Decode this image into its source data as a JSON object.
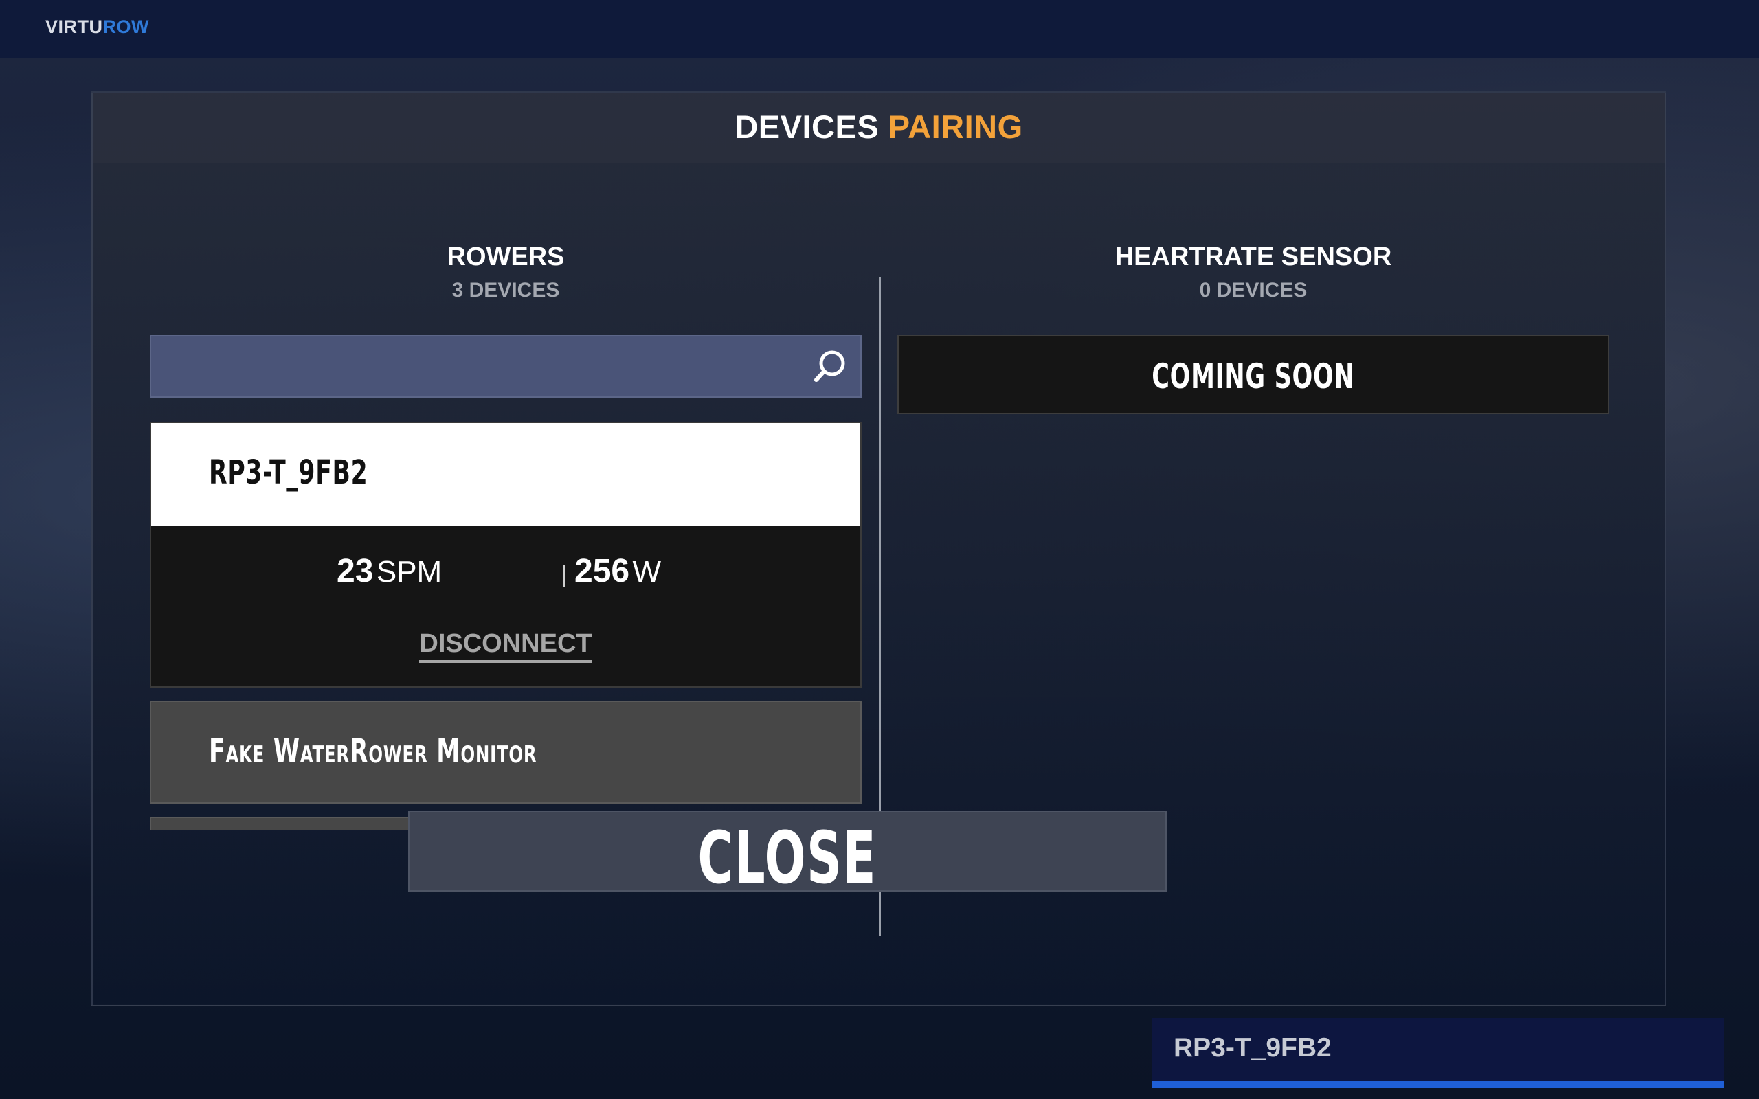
{
  "app": {
    "logo_part1": "VIRTU",
    "logo_part2": "ROW",
    "brand_color": "#2f7ad9"
  },
  "dialog": {
    "title_part1": "DEVICES",
    "title_part2": "PAIRING",
    "accent_color": "#f3a23a"
  },
  "rowers": {
    "heading": "ROWERS",
    "count": "3 DEVICES",
    "search": {
      "value": "",
      "icon": "search-icon"
    },
    "devices": [
      {
        "name": "RP3-T_9FB2",
        "connected": true,
        "spm_value": "23",
        "spm_unit": "SPM",
        "power_value": "256",
        "power_unit": "W",
        "action_label": "DISCONNECT"
      },
      {
        "name": "Fake WaterRower Monitor",
        "connected": false
      }
    ]
  },
  "heartrate": {
    "heading": "HEARTRATE SENSOR",
    "count": "0 DEVICES",
    "placeholder": "COMING SOON"
  },
  "footer": {
    "close_label": "CLOSE"
  },
  "toast": {
    "text": "RP3-T_9FB2",
    "progress": 1.0,
    "progress_color": "#1f5fd6"
  }
}
